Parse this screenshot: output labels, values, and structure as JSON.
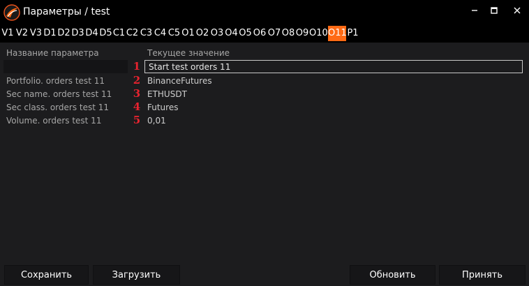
{
  "window": {
    "title": "Параметры / test",
    "controls": [
      "minimize-icon",
      "maximize-icon",
      "close-icon"
    ]
  },
  "tabs": [
    {
      "label": "V1",
      "active": false
    },
    {
      "label": "V2",
      "active": false
    },
    {
      "label": "V3",
      "active": false
    },
    {
      "label": "D1",
      "active": false
    },
    {
      "label": "D2",
      "active": false
    },
    {
      "label": "D3",
      "active": false
    },
    {
      "label": "D4",
      "active": false
    },
    {
      "label": "D5",
      "active": false
    },
    {
      "label": "C1",
      "active": false
    },
    {
      "label": "C2",
      "active": false
    },
    {
      "label": "C3",
      "active": false
    },
    {
      "label": "C4",
      "active": false
    },
    {
      "label": "C5",
      "active": false
    },
    {
      "label": "O1",
      "active": false
    },
    {
      "label": "O2",
      "active": false
    },
    {
      "label": "O3",
      "active": false
    },
    {
      "label": "O4",
      "active": false
    },
    {
      "label": "O5",
      "active": false
    },
    {
      "label": "O6",
      "active": false
    },
    {
      "label": "O7",
      "active": false
    },
    {
      "label": "O8",
      "active": false
    },
    {
      "label": "O9",
      "active": false
    },
    {
      "label": "O10",
      "active": false
    },
    {
      "label": "O11",
      "active": true
    },
    {
      "label": "P1",
      "active": false
    }
  ],
  "table": {
    "header_name": "Название параметра",
    "header_value": "Текущее значение",
    "rows": [
      {
        "name": "",
        "number": "1",
        "value": "Start test orders 11",
        "editing": true
      },
      {
        "name": "Portfolio. orders test 11",
        "number": "2",
        "value": "BinanceFutures"
      },
      {
        "name": "Sec name. orders test 11",
        "number": "3",
        "value": "ETHUSDT"
      },
      {
        "name": "Sec class. orders test 11",
        "number": "4",
        "value": "Futures"
      },
      {
        "name": "Volume. orders test 11",
        "number": "5",
        "value": "0,01"
      }
    ]
  },
  "buttons": {
    "save": "Сохранить",
    "load": "Загрузить",
    "refresh": "Обновить",
    "accept": "Принять"
  },
  "colors": {
    "accent": "#ff6a14",
    "annotation": "#e8232f",
    "background": "#1c1c1e",
    "titlebar": "#000000"
  }
}
